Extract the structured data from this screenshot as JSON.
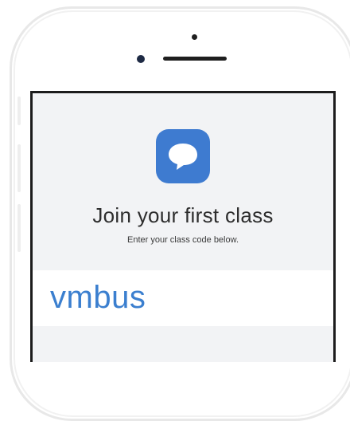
{
  "screen": {
    "app_icon": "speech-bubble-icon",
    "title": "Join your first class",
    "subtitle": "Enter your class code below.",
    "class_code_value": "vmbus"
  },
  "colors": {
    "accent": "#3b7fcf",
    "icon_background": "#3e7bd0",
    "screen_background": "#f2f3f5"
  }
}
